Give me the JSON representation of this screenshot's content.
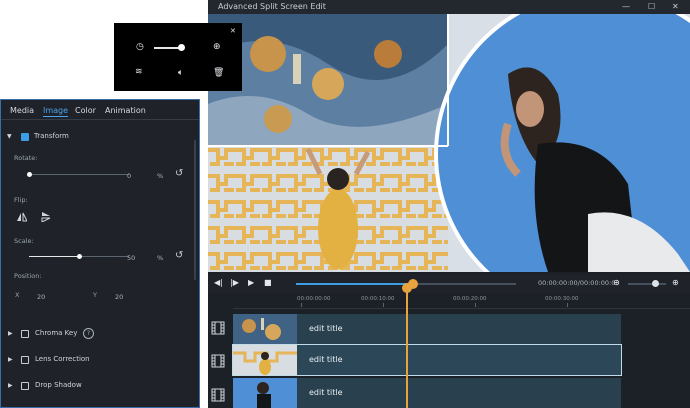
{
  "window": {
    "title": "Advanced Split Screen Edit",
    "controls": {
      "minimize": "—",
      "maximize": "☐",
      "close": "✕"
    }
  },
  "popup": {
    "icons": [
      "timer-icon",
      "add-icon",
      "close-icon",
      "delete-icon",
      "speed-icon",
      "volume-icon"
    ],
    "slider_value": 1.0
  },
  "panel": {
    "tabs": [
      "Media",
      "Image",
      "Color",
      "Animation"
    ],
    "active_tab": "Image",
    "transform": {
      "label": "Transform",
      "checked": true,
      "rotate": {
        "label": "Rotate:",
        "value": "0",
        "unit": "%",
        "level": 0.0
      },
      "flip": {
        "label": "Flip:"
      },
      "scale": {
        "label": "Scale:",
        "value": "50",
        "unit": "%",
        "level": 0.5
      },
      "position": {
        "label": "Position:",
        "x_label": "X",
        "x_value": "20",
        "y_label": "Y",
        "y_value": "20"
      }
    },
    "sections": [
      {
        "label": "Chroma Key",
        "help": "?"
      },
      {
        "label": "Lens Correction"
      },
      {
        "label": "Drop Shadow"
      }
    ]
  },
  "player": {
    "timecode": "00:00:00:00/00:00:00:00",
    "progress": 0.53,
    "zoom": 0.7
  },
  "timeline": {
    "ticks": [
      "00:00:00:00",
      "00:00:10:00",
      "00:00:20:00",
      "00:00:30:00"
    ],
    "tracks": [
      {
        "label": "edit title",
        "selected": false
      },
      {
        "label": "edit title",
        "selected": true
      },
      {
        "label": "edit title",
        "selected": false
      }
    ]
  },
  "colors": {
    "accent": "#3c9ce4",
    "playhead": "#e7a33e",
    "track": "#29404f",
    "sky": "#4f8fd6",
    "pattern_yellow": "#e6b557"
  }
}
